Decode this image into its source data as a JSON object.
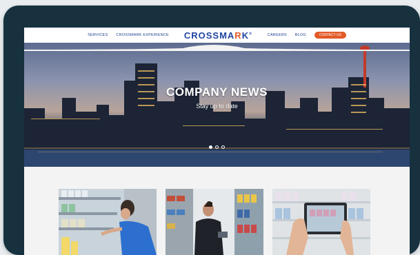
{
  "nav": {
    "links": [
      "SERVICES",
      "CROSSMARK EXPERIENCE"
    ],
    "logo": {
      "prefix": "CROSSMA",
      "accent": "R",
      "suffix": "K",
      "mark": "®"
    },
    "right_links": [
      "CAREERS",
      "BLOG"
    ],
    "contact": "CONTACT US"
  },
  "hero": {
    "title": "COMPANY NEWS",
    "subtitle": "Stay up to date",
    "slides": 3,
    "active_slide": 1
  },
  "cards": [
    {
      "scene": "shopper-stocking-shelf"
    },
    {
      "scene": "merchandiser-with-tablet"
    },
    {
      "scene": "phone-photographing-shelf"
    }
  ],
  "colors": {
    "device": "#17313f",
    "brand_blue": "#2045a0",
    "accent_orange": "#e25a28"
  }
}
